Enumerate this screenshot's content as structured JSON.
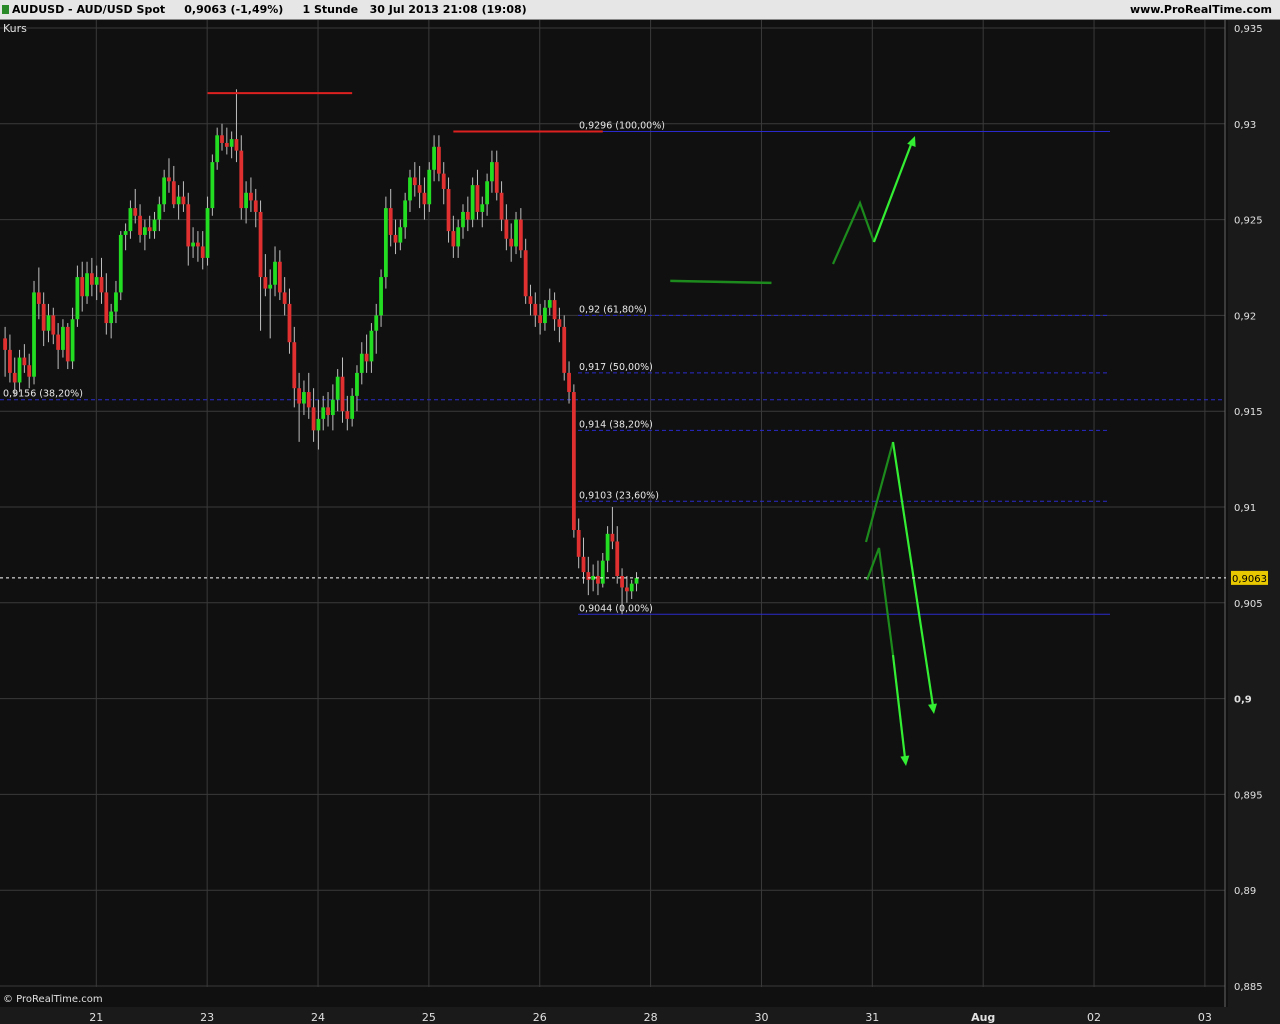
{
  "header": {
    "title": "AUDUSD - AUD/USD Spot     0,9063 (-1,49%)     1 Stunde   30 Jul 2013 21:08 (19:08)",
    "brand": "www.ProRealTime.com"
  },
  "panel_label": "Kurs",
  "watermark": "© ProRealTime.com",
  "current_price_label": "0,9063",
  "colors": {
    "background": "#101010",
    "grid": "#3a3a3a",
    "bull": "#22dd22",
    "bear": "#e03030",
    "wick": "#bfbfbf",
    "fib": "#2a2acc",
    "resistance": "#dd2020",
    "arrow_dark": "#1c8a1c",
    "arrow_light": "#33ee33",
    "price_tag": "#e8c800"
  },
  "chart_data": {
    "type": "candlestick",
    "ylim": [
      0.8845,
      0.9352
    ],
    "y_ticks": [
      {
        "value": 0.935,
        "label": "0,935"
      },
      {
        "value": 0.93,
        "label": "0,93"
      },
      {
        "value": 0.925,
        "label": "0,925"
      },
      {
        "value": 0.92,
        "label": "0,92"
      },
      {
        "value": 0.915,
        "label": "0,915"
      },
      {
        "value": 0.91,
        "label": "0,91"
      },
      {
        "value": 0.905,
        "label": "0,905"
      },
      {
        "value": 0.9,
        "label": "0,9"
      },
      {
        "value": 0.895,
        "label": "0,895"
      },
      {
        "value": 0.89,
        "label": "0,89"
      },
      {
        "value": 0.885,
        "label": "0,885"
      }
    ],
    "x_ticks": [
      {
        "bar": 10,
        "label": "21"
      },
      {
        "bar": 33,
        "label": "23"
      },
      {
        "bar": 56,
        "label": "24"
      },
      {
        "bar": 79,
        "label": "25"
      },
      {
        "bar": 102,
        "label": "26"
      },
      {
        "bar": 125,
        "label": "28"
      },
      {
        "bar": 148,
        "label": "30"
      },
      {
        "bar": 171,
        "label": "31"
      },
      {
        "bar": 194,
        "label": "Aug"
      },
      {
        "bar": 217,
        "label": "02"
      },
      {
        "bar": 240,
        "label": "03"
      }
    ],
    "candles": [
      [
        0.9188,
        0.9194,
        0.9168,
        0.9182
      ],
      [
        0.9182,
        0.919,
        0.9165,
        0.917
      ],
      [
        0.917,
        0.9178,
        0.9158,
        0.9165
      ],
      [
        0.9165,
        0.9182,
        0.916,
        0.9178
      ],
      [
        0.9178,
        0.9185,
        0.917,
        0.9174
      ],
      [
        0.9174,
        0.918,
        0.9162,
        0.9168
      ],
      [
        0.9168,
        0.9218,
        0.9164,
        0.9212
      ],
      [
        0.9212,
        0.9225,
        0.9198,
        0.9206
      ],
      [
        0.9206,
        0.9212,
        0.9184,
        0.9192
      ],
      [
        0.9192,
        0.9206,
        0.9186,
        0.92
      ],
      [
        0.92,
        0.9204,
        0.9185,
        0.919
      ],
      [
        0.919,
        0.9196,
        0.9172,
        0.9182
      ],
      [
        0.9182,
        0.9198,
        0.9178,
        0.9194
      ],
      [
        0.9194,
        0.9196,
        0.9172,
        0.9176
      ],
      [
        0.9176,
        0.9204,
        0.9172,
        0.9198
      ],
      [
        0.9198,
        0.9226,
        0.9194,
        0.922
      ],
      [
        0.922,
        0.9228,
        0.9202,
        0.921
      ],
      [
        0.921,
        0.9228,
        0.9206,
        0.9222
      ],
      [
        0.9222,
        0.923,
        0.921,
        0.9216
      ],
      [
        0.9216,
        0.9226,
        0.9208,
        0.922
      ],
      [
        0.922,
        0.923,
        0.9206,
        0.9212
      ],
      [
        0.9212,
        0.9222,
        0.919,
        0.9196
      ],
      [
        0.9196,
        0.9206,
        0.9188,
        0.9202
      ],
      [
        0.9202,
        0.9218,
        0.9196,
        0.9212
      ],
      [
        0.9212,
        0.9244,
        0.9208,
        0.9242
      ],
      [
        0.9242,
        0.9248,
        0.9234,
        0.9244
      ],
      [
        0.9244,
        0.926,
        0.924,
        0.9256
      ],
      [
        0.9256,
        0.9266,
        0.9248,
        0.9252
      ],
      [
        0.9252,
        0.9258,
        0.9238,
        0.9242
      ],
      [
        0.9242,
        0.925,
        0.9234,
        0.9246
      ],
      [
        0.9246,
        0.9252,
        0.924,
        0.9244
      ],
      [
        0.9244,
        0.9254,
        0.924,
        0.925
      ],
      [
        0.925,
        0.9262,
        0.9244,
        0.9258
      ],
      [
        0.9258,
        0.9276,
        0.9254,
        0.9272
      ],
      [
        0.9272,
        0.9282,
        0.9264,
        0.927
      ],
      [
        0.927,
        0.9278,
        0.9256,
        0.9258
      ],
      [
        0.9258,
        0.9268,
        0.925,
        0.9262
      ],
      [
        0.9262,
        0.927,
        0.9254,
        0.9258
      ],
      [
        0.9258,
        0.9264,
        0.9226,
        0.9236
      ],
      [
        0.9236,
        0.9246,
        0.923,
        0.9238
      ],
      [
        0.9238,
        0.9244,
        0.9228,
        0.9236
      ],
      [
        0.9236,
        0.9244,
        0.9224,
        0.923
      ],
      [
        0.923,
        0.9262,
        0.9226,
        0.9256
      ],
      [
        0.9256,
        0.9284,
        0.9252,
        0.928
      ],
      [
        0.928,
        0.9298,
        0.9276,
        0.9294
      ],
      [
        0.9294,
        0.93,
        0.9286,
        0.929
      ],
      [
        0.929,
        0.9298,
        0.9284,
        0.9288
      ],
      [
        0.9288,
        0.9296,
        0.9282,
        0.9292
      ],
      [
        0.9292,
        0.9318,
        0.928,
        0.9286
      ],
      [
        0.9286,
        0.9294,
        0.925,
        0.9256
      ],
      [
        0.9256,
        0.927,
        0.9248,
        0.9264
      ],
      [
        0.9264,
        0.9272,
        0.9254,
        0.926
      ],
      [
        0.926,
        0.9266,
        0.9246,
        0.9254
      ],
      [
        0.9254,
        0.926,
        0.9192,
        0.922
      ],
      [
        0.922,
        0.9232,
        0.921,
        0.9214
      ],
      [
        0.9214,
        0.9224,
        0.9188,
        0.9216
      ],
      [
        0.9216,
        0.9236,
        0.921,
        0.9228
      ],
      [
        0.9228,
        0.9234,
        0.9208,
        0.9212
      ],
      [
        0.9212,
        0.922,
        0.92,
        0.9206
      ],
      [
        0.9206,
        0.9214,
        0.918,
        0.9186
      ],
      [
        0.9186,
        0.9194,
        0.9152,
        0.9162
      ],
      [
        0.9162,
        0.917,
        0.9134,
        0.9154
      ],
      [
        0.9154,
        0.9166,
        0.9148,
        0.916
      ],
      [
        0.916,
        0.917,
        0.9146,
        0.9152
      ],
      [
        0.9152,
        0.9162,
        0.9134,
        0.914
      ],
      [
        0.914,
        0.9156,
        0.913,
        0.9146
      ],
      [
        0.9146,
        0.9158,
        0.914,
        0.9152
      ],
      [
        0.9152,
        0.916,
        0.9142,
        0.9148
      ],
      [
        0.9148,
        0.9164,
        0.914,
        0.9156
      ],
      [
        0.9156,
        0.9172,
        0.915,
        0.9168
      ],
      [
        0.9168,
        0.9178,
        0.9144,
        0.915
      ],
      [
        0.915,
        0.9158,
        0.914,
        0.9146
      ],
      [
        0.9146,
        0.9162,
        0.9142,
        0.9158
      ],
      [
        0.9158,
        0.9174,
        0.915,
        0.917
      ],
      [
        0.917,
        0.9186,
        0.9164,
        0.918
      ],
      [
        0.918,
        0.919,
        0.917,
        0.9176
      ],
      [
        0.9176,
        0.9196,
        0.917,
        0.9192
      ],
      [
        0.9192,
        0.9206,
        0.918,
        0.92
      ],
      [
        0.92,
        0.9224,
        0.9194,
        0.922
      ],
      [
        0.922,
        0.9262,
        0.9214,
        0.9256
      ],
      [
        0.9256,
        0.9266,
        0.9236,
        0.9242
      ],
      [
        0.9242,
        0.925,
        0.9232,
        0.9238
      ],
      [
        0.9238,
        0.925,
        0.9234,
        0.9246
      ],
      [
        0.9246,
        0.9264,
        0.924,
        0.926
      ],
      [
        0.926,
        0.9276,
        0.9254,
        0.9272
      ],
      [
        0.9272,
        0.928,
        0.9262,
        0.9268
      ],
      [
        0.9268,
        0.9278,
        0.9256,
        0.9264
      ],
      [
        0.9264,
        0.9272,
        0.925,
        0.9258
      ],
      [
        0.9258,
        0.928,
        0.9254,
        0.9276
      ],
      [
        0.9276,
        0.9294,
        0.927,
        0.9288
      ],
      [
        0.9288,
        0.9294,
        0.927,
        0.9274
      ],
      [
        0.9274,
        0.928,
        0.9258,
        0.9266
      ],
      [
        0.9266,
        0.9272,
        0.9238,
        0.9244
      ],
      [
        0.9244,
        0.9252,
        0.923,
        0.9236
      ],
      [
        0.9236,
        0.925,
        0.923,
        0.9246
      ],
      [
        0.9246,
        0.9258,
        0.924,
        0.9254
      ],
      [
        0.9254,
        0.9262,
        0.9244,
        0.925
      ],
      [
        0.925,
        0.9272,
        0.9246,
        0.9268
      ],
      [
        0.9268,
        0.9276,
        0.925,
        0.9254
      ],
      [
        0.9254,
        0.9262,
        0.9246,
        0.9258
      ],
      [
        0.9258,
        0.9274,
        0.9252,
        0.927
      ],
      [
        0.927,
        0.9286,
        0.9264,
        0.928
      ],
      [
        0.928,
        0.9286,
        0.926,
        0.9264
      ],
      [
        0.9264,
        0.927,
        0.9244,
        0.925
      ],
      [
        0.925,
        0.9258,
        0.9234,
        0.924
      ],
      [
        0.924,
        0.9248,
        0.9228,
        0.9236
      ],
      [
        0.9236,
        0.9254,
        0.9232,
        0.925
      ],
      [
        0.925,
        0.9256,
        0.923,
        0.9234
      ],
      [
        0.9234,
        0.924,
        0.9206,
        0.921
      ],
      [
        0.921,
        0.9216,
        0.92,
        0.9206
      ],
      [
        0.9206,
        0.9212,
        0.9194,
        0.92
      ],
      [
        0.92,
        0.9206,
        0.919,
        0.9196
      ],
      [
        0.9196,
        0.9208,
        0.9192,
        0.9204
      ],
      [
        0.9204,
        0.9214,
        0.92,
        0.9208
      ],
      [
        0.9208,
        0.9212,
        0.9192,
        0.9198
      ],
      [
        0.9198,
        0.9204,
        0.9186,
        0.9194
      ],
      [
        0.9194,
        0.92,
        0.9166,
        0.917
      ],
      [
        0.917,
        0.9176,
        0.9154,
        0.916
      ],
      [
        0.916,
        0.9164,
        0.9084,
        0.9088
      ],
      [
        0.9088,
        0.9094,
        0.9068,
        0.9074
      ],
      [
        0.9074,
        0.9084,
        0.906,
        0.9066
      ],
      [
        0.9066,
        0.9074,
        0.9054,
        0.9062
      ],
      [
        0.9062,
        0.907,
        0.9056,
        0.9064
      ],
      [
        0.9064,
        0.9072,
        0.9054,
        0.906
      ],
      [
        0.906,
        0.9076,
        0.9058,
        0.9072
      ],
      [
        0.9072,
        0.909,
        0.9066,
        0.9086
      ],
      [
        0.9086,
        0.91,
        0.9078,
        0.9082
      ],
      [
        0.9082,
        0.909,
        0.906,
        0.9064
      ],
      [
        0.9064,
        0.9068,
        0.9044,
        0.9058
      ],
      [
        0.9058,
        0.9064,
        0.905,
        0.9056
      ],
      [
        0.9056,
        0.9062,
        0.9052,
        0.906
      ],
      [
        0.906,
        0.9066,
        0.9056,
        0.9063
      ]
    ],
    "fibonacci": [
      {
        "value": 0.9296,
        "label": "0,9296 (100,00%)"
      },
      {
        "value": 0.92,
        "label": "0,92 (61,80%)"
      },
      {
        "value": 0.917,
        "label": "0,917 (50,00%)"
      },
      {
        "value": 0.914,
        "label": "0,914 (38,20%)"
      },
      {
        "value": 0.9103,
        "label": "0,9103 (23,60%)"
      },
      {
        "value": 0.9044,
        "label": "0,9044 (0,00%)"
      }
    ],
    "left_fib": {
      "value": 0.9156,
      "label": "0,9156 (38,20%)"
    },
    "current_price": 0.9063,
    "resistance_lines": [
      {
        "bar_from": 42,
        "bar_to": 72,
        "value": 0.9316
      },
      {
        "bar_from": 93,
        "bar_to": 124,
        "value": 0.9296
      }
    ],
    "support_line": {
      "bar_from": 138,
      "bar_to": 159,
      "value": 0.9218
    }
  }
}
